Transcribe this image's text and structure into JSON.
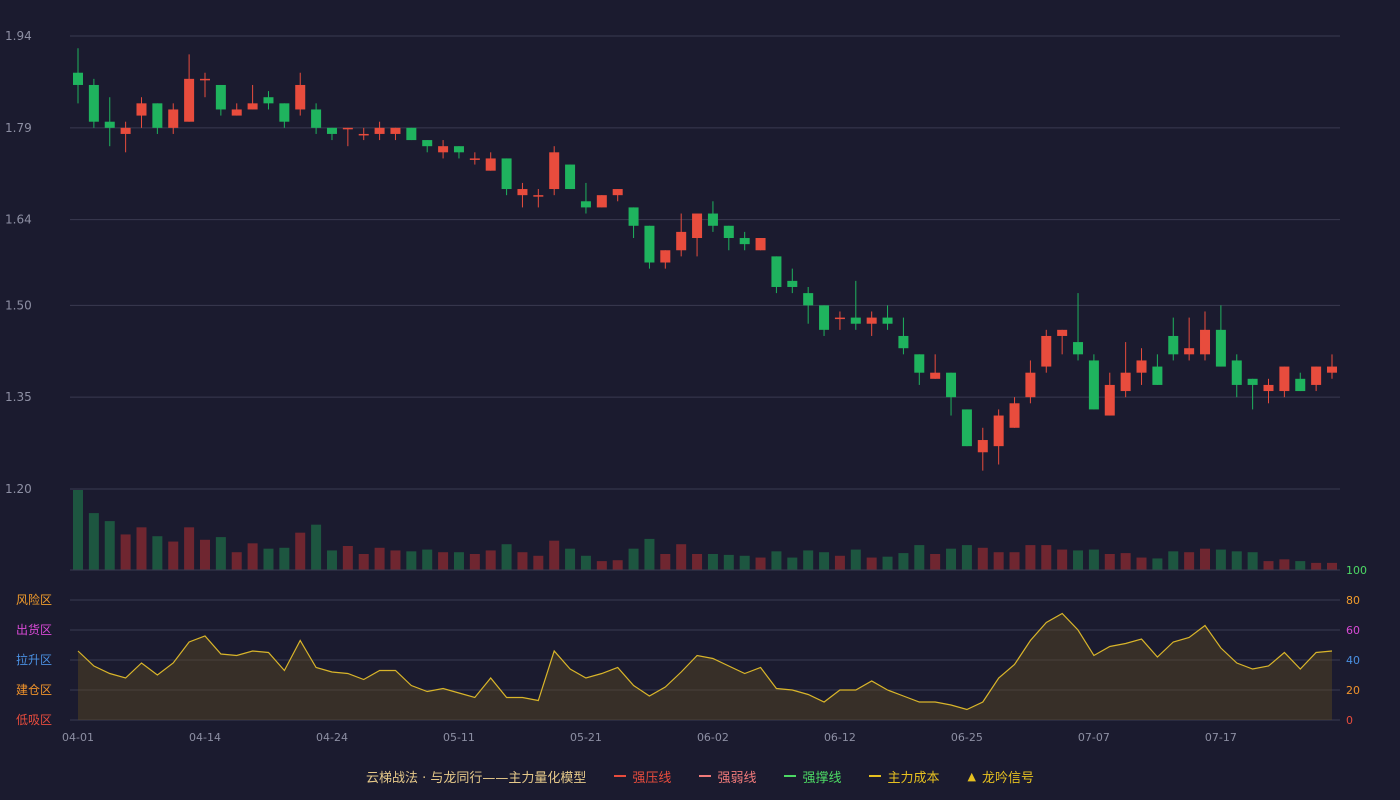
{
  "colors": {
    "background": "#1b1b2f",
    "up": "#e84c3d",
    "down": "#1fb35e",
    "vol_up": "#6f2630",
    "vol_down": "#1d5640",
    "grid": "#3a3b50",
    "axis_text": "#8d8fa3",
    "cost_line": "#d9b52a"
  },
  "price_axis": {
    "ticks": [
      "1.20",
      "1.35",
      "1.50",
      "1.64",
      "1.79",
      "1.94"
    ],
    "min": 1.2,
    "max": 1.94
  },
  "x_axis": {
    "labels": [
      {
        "text": "04-01",
        "i": 0
      },
      {
        "text": "04-14",
        "i": 8
      },
      {
        "text": "04-24",
        "i": 16
      },
      {
        "text": "05-11",
        "i": 24
      },
      {
        "text": "05-21",
        "i": 32
      },
      {
        "text": "06-02",
        "i": 40
      },
      {
        "text": "06-12",
        "i": 48
      },
      {
        "text": "06-25",
        "i": 56
      },
      {
        "text": "07-07",
        "i": 64
      },
      {
        "text": "07-17",
        "i": 72
      }
    ]
  },
  "zone_axis": {
    "levels": [
      {
        "value": "100",
        "color": "#4cd964"
      },
      {
        "value": "80",
        "color": "#f39c2b"
      },
      {
        "value": "60",
        "color": "#d94ad6"
      },
      {
        "value": "40",
        "color": "#4a90e2"
      },
      {
        "value": "20",
        "color": "#f0932b"
      },
      {
        "value": "0",
        "color": "#e84c3d"
      }
    ],
    "zones": [
      {
        "label": "风险区",
        "color": "#f39c2b",
        "level": 80
      },
      {
        "label": "出货区",
        "color": "#d94ad6",
        "level": 60
      },
      {
        "label": "拉升区",
        "color": "#4a90e2",
        "level": 40
      },
      {
        "label": "建仓区",
        "color": "#f0932b",
        "level": 20
      },
      {
        "label": "低吸区",
        "color": "#e84c3d",
        "level": 0
      }
    ]
  },
  "legend": {
    "title": "云梯战法 · 与龙同行——主力量化模型",
    "title_color": "#e6c98a",
    "items": [
      {
        "label": "强压线",
        "color": "#e84c3d",
        "style": "solid"
      },
      {
        "label": "强弱线",
        "color": "#f07a7a",
        "style": "dash"
      },
      {
        "label": "强撑线",
        "color": "#4cd964",
        "style": "solid"
      },
      {
        "label": "主力成本",
        "color": "#e6c020",
        "style": "dash"
      },
      {
        "label": "龙吟信号",
        "color": "#e6c020",
        "style": "triangle",
        "symbol": "▲"
      }
    ]
  },
  "chart_data": {
    "type": "candlestick",
    "count": 80,
    "price_range": [
      1.2,
      1.94
    ],
    "candles": [
      [
        1.88,
        1.86,
        1.92,
        1.83
      ],
      [
        1.86,
        1.8,
        1.87,
        1.79
      ],
      [
        1.8,
        1.79,
        1.84,
        1.76
      ],
      [
        1.78,
        1.79,
        1.8,
        1.75
      ],
      [
        1.81,
        1.83,
        1.84,
        1.79
      ],
      [
        1.83,
        1.79,
        1.83,
        1.78
      ],
      [
        1.79,
        1.82,
        1.83,
        1.78
      ],
      [
        1.8,
        1.87,
        1.91,
        1.8
      ],
      [
        1.87,
        1.87,
        1.88,
        1.84
      ],
      [
        1.86,
        1.82,
        1.86,
        1.81
      ],
      [
        1.81,
        1.82,
        1.83,
        1.81
      ],
      [
        1.82,
        1.83,
        1.86,
        1.82
      ],
      [
        1.84,
        1.83,
        1.85,
        1.82
      ],
      [
        1.83,
        1.8,
        1.83,
        1.79
      ],
      [
        1.82,
        1.86,
        1.88,
        1.81
      ],
      [
        1.82,
        1.79,
        1.83,
        1.78
      ],
      [
        1.79,
        1.78,
        1.79,
        1.77
      ],
      [
        1.79,
        1.79,
        1.79,
        1.76
      ],
      [
        1.78,
        1.78,
        1.79,
        1.77
      ],
      [
        1.78,
        1.79,
        1.8,
        1.77
      ],
      [
        1.78,
        1.79,
        1.79,
        1.77
      ],
      [
        1.79,
        1.77,
        1.79,
        1.77
      ],
      [
        1.77,
        1.76,
        1.77,
        1.75
      ],
      [
        1.75,
        1.76,
        1.77,
        1.74
      ],
      [
        1.76,
        1.75,
        1.76,
        1.74
      ],
      [
        1.74,
        1.74,
        1.75,
        1.73
      ],
      [
        1.72,
        1.74,
        1.75,
        1.72
      ],
      [
        1.74,
        1.69,
        1.74,
        1.68
      ],
      [
        1.68,
        1.69,
        1.7,
        1.66
      ],
      [
        1.68,
        1.68,
        1.69,
        1.66
      ],
      [
        1.69,
        1.75,
        1.76,
        1.68
      ],
      [
        1.73,
        1.69,
        1.73,
        1.69
      ],
      [
        1.67,
        1.66,
        1.7,
        1.65
      ],
      [
        1.66,
        1.68,
        1.68,
        1.66
      ],
      [
        1.68,
        1.69,
        1.69,
        1.67
      ],
      [
        1.66,
        1.63,
        1.66,
        1.61
      ],
      [
        1.63,
        1.57,
        1.63,
        1.56
      ],
      [
        1.57,
        1.59,
        1.59,
        1.56
      ],
      [
        1.59,
        1.62,
        1.65,
        1.58
      ],
      [
        1.61,
        1.65,
        1.65,
        1.58
      ],
      [
        1.65,
        1.63,
        1.67,
        1.62
      ],
      [
        1.63,
        1.61,
        1.63,
        1.59
      ],
      [
        1.61,
        1.6,
        1.62,
        1.59
      ],
      [
        1.59,
        1.61,
        1.61,
        1.59
      ],
      [
        1.58,
        1.53,
        1.58,
        1.52
      ],
      [
        1.54,
        1.53,
        1.56,
        1.52
      ],
      [
        1.52,
        1.5,
        1.53,
        1.47
      ],
      [
        1.5,
        1.46,
        1.5,
        1.45
      ],
      [
        1.48,
        1.48,
        1.49,
        1.46
      ],
      [
        1.48,
        1.47,
        1.54,
        1.46
      ],
      [
        1.47,
        1.48,
        1.49,
        1.45
      ],
      [
        1.48,
        1.47,
        1.5,
        1.46
      ],
      [
        1.45,
        1.43,
        1.48,
        1.42
      ],
      [
        1.42,
        1.39,
        1.42,
        1.37
      ],
      [
        1.38,
        1.39,
        1.42,
        1.38
      ],
      [
        1.39,
        1.35,
        1.39,
        1.32
      ],
      [
        1.33,
        1.27,
        1.33,
        1.27
      ],
      [
        1.26,
        1.28,
        1.3,
        1.23
      ],
      [
        1.27,
        1.32,
        1.33,
        1.24
      ],
      [
        1.3,
        1.34,
        1.35,
        1.3
      ],
      [
        1.35,
        1.39,
        1.41,
        1.34
      ],
      [
        1.4,
        1.45,
        1.46,
        1.39
      ],
      [
        1.45,
        1.46,
        1.46,
        1.42
      ],
      [
        1.44,
        1.42,
        1.52,
        1.41
      ],
      [
        1.41,
        1.33,
        1.42,
        1.33
      ],
      [
        1.32,
        1.37,
        1.39,
        1.32
      ],
      [
        1.36,
        1.39,
        1.44,
        1.35
      ],
      [
        1.39,
        1.41,
        1.43,
        1.37
      ],
      [
        1.4,
        1.37,
        1.42,
        1.37
      ],
      [
        1.45,
        1.42,
        1.48,
        1.41
      ],
      [
        1.42,
        1.43,
        1.48,
        1.41
      ],
      [
        1.42,
        1.46,
        1.49,
        1.41
      ],
      [
        1.46,
        1.4,
        1.5,
        1.4
      ],
      [
        1.41,
        1.37,
        1.42,
        1.35
      ],
      [
        1.38,
        1.37,
        1.38,
        1.33
      ],
      [
        1.36,
        1.37,
        1.38,
        1.34
      ],
      [
        1.36,
        1.4,
        1.4,
        1.35
      ],
      [
        1.38,
        1.36,
        1.39,
        1.36
      ],
      [
        1.37,
        1.4,
        1.4,
        1.36
      ],
      [
        1.39,
        1.4,
        1.42,
        1.38
      ]
    ],
    "volume": [
      90,
      64,
      55,
      40,
      48,
      38,
      32,
      48,
      34,
      37,
      20,
      30,
      24,
      25,
      42,
      51,
      22,
      27,
      18,
      25,
      22,
      21,
      23,
      20,
      20,
      18,
      22,
      29,
      20,
      16,
      33,
      24,
      16,
      10,
      11,
      24,
      35,
      18,
      29,
      18,
      18,
      17,
      16,
      14,
      21,
      14,
      22,
      20,
      16,
      23,
      14,
      15,
      19,
      28,
      18,
      24,
      28,
      25,
      20,
      20,
      28,
      28,
      23,
      22,
      23,
      18,
      19,
      14,
      13,
      21,
      20,
      24,
      23,
      21,
      20,
      10,
      12,
      10,
      8,
      8
    ],
    "cost_line": [
      46,
      36,
      31,
      28,
      38,
      30,
      38,
      52,
      56,
      44,
      43,
      46,
      45,
      33,
      53,
      35,
      32,
      31,
      27,
      33,
      33,
      23,
      19,
      21,
      18,
      15,
      28,
      15,
      15,
      13,
      46,
      34,
      28,
      31,
      35,
      23,
      16,
      22,
      32,
      43,
      41,
      36,
      31,
      35,
      21,
      20,
      17,
      12,
      20,
      20,
      26,
      20,
      16,
      12,
      12,
      10,
      7,
      12,
      28,
      37,
      53,
      65,
      71,
      60,
      43,
      49,
      51,
      54,
      42,
      52,
      55,
      63,
      48,
      38,
      34,
      36,
      45,
      34,
      45,
      46
    ]
  }
}
